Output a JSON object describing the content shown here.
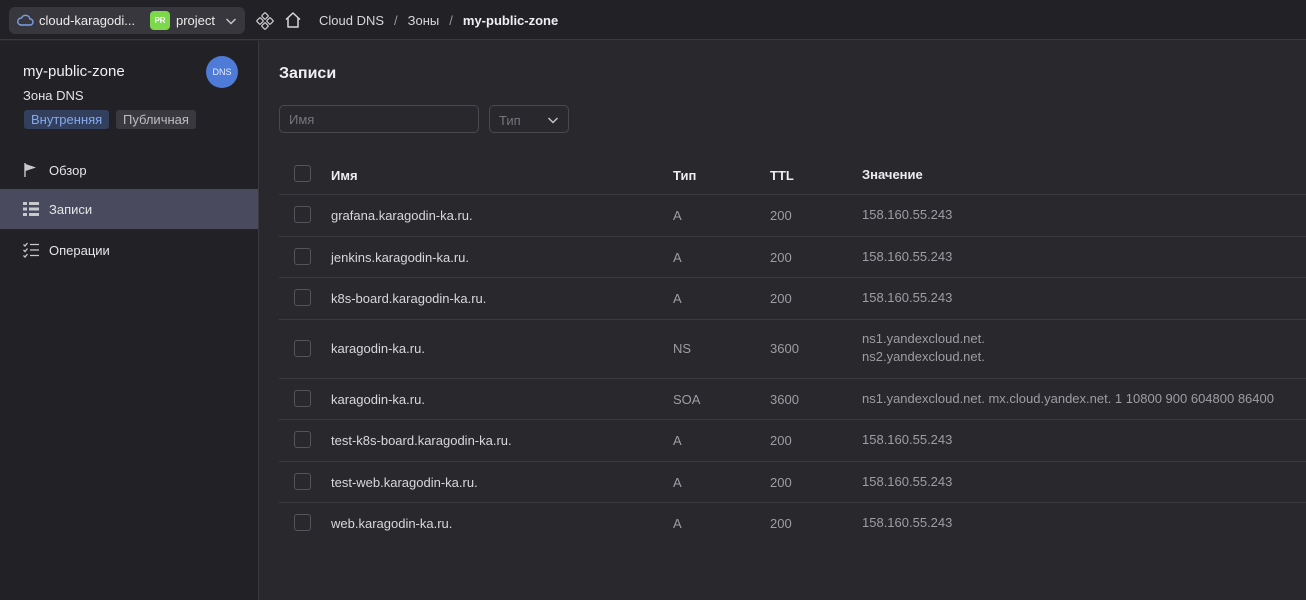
{
  "topbar": {
    "cloud_name": "cloud-karagodi...",
    "project_badge": "PR",
    "project_name": "project",
    "breadcrumb": [
      "Cloud DNS",
      "Зоны",
      "my-public-zone"
    ],
    "breadcrumb_sep": "/"
  },
  "sidebar": {
    "zone_title": "my-public-zone",
    "zone_sub": "Зона DNS",
    "avatar": "DNS",
    "tags": [
      "Внутренняя",
      "Публичная"
    ],
    "nav": [
      {
        "label": "Обзор",
        "icon": "flag-icon"
      },
      {
        "label": "Записи",
        "icon": "list-icon",
        "active": true
      },
      {
        "label": "Операции",
        "icon": "checklist-icon"
      }
    ]
  },
  "main": {
    "title": "Записи",
    "name_placeholder": "Имя",
    "type_placeholder": "Тип",
    "columns": [
      "Имя",
      "Тип",
      "TTL",
      "Значение"
    ],
    "rows": [
      {
        "name": "grafana.karagodin-ka.ru.",
        "type": "A",
        "ttl": "200",
        "value": [
          "158.160.55.243"
        ]
      },
      {
        "name": "jenkins.karagodin-ka.ru.",
        "type": "A",
        "ttl": "200",
        "value": [
          "158.160.55.243"
        ]
      },
      {
        "name": "k8s-board.karagodin-ka.ru.",
        "type": "A",
        "ttl": "200",
        "value": [
          "158.160.55.243"
        ]
      },
      {
        "name": "karagodin-ka.ru.",
        "type": "NS",
        "ttl": "3600",
        "value": [
          "ns1.yandexcloud.net.",
          "ns2.yandexcloud.net."
        ]
      },
      {
        "name": "karagodin-ka.ru.",
        "type": "SOA",
        "ttl": "3600",
        "value": [
          "ns1.yandexcloud.net. mx.cloud.yandex.net. 1 10800 900 604800 86400"
        ]
      },
      {
        "name": "test-k8s-board.karagodin-ka.ru.",
        "type": "A",
        "ttl": "200",
        "value": [
          "158.160.55.243"
        ]
      },
      {
        "name": "test-web.karagodin-ka.ru.",
        "type": "A",
        "ttl": "200",
        "value": [
          "158.160.55.243"
        ]
      },
      {
        "name": "web.karagodin-ka.ru.",
        "type": "A",
        "ttl": "200",
        "value": [
          "158.160.55.243"
        ]
      }
    ]
  },
  "colors": {
    "background": "#29282d",
    "sidebar": "#222125",
    "active_nav": "#4a4a5f",
    "accent_blue": "#4e7ad8",
    "project_green": "#7bd94a"
  }
}
